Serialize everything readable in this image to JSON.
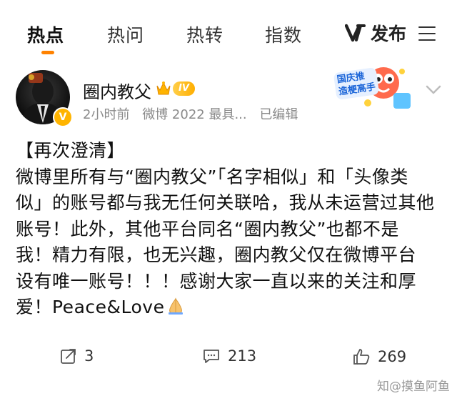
{
  "nav": {
    "tabs": [
      {
        "label": "热点",
        "active": true
      },
      {
        "label": "热问",
        "active": false
      },
      {
        "label": "热转",
        "active": false
      },
      {
        "label": "指数",
        "active": false
      }
    ],
    "publish_label": "发布",
    "accent": "#ff8200"
  },
  "post": {
    "username": "圈内教父",
    "level": "IV",
    "time": "2小时前",
    "source": "微博 2022 最具...",
    "edited": "已编辑",
    "promo": {
      "line1": "国庆推",
      "line2": "造梗高手"
    },
    "lines": [
      "【再次澄清】",
      "微博里所有与“圈内教父”「名字相似」和「头像类",
      "似」的账号都与我无任何关联哈，我从未运营过其他",
      "账号！此外，其他平台同名“圈内教父”也都不是",
      "我！精力有限，也无兴趣，圈内教父仅在微博平台",
      "设有唯一账号！！！感谢大家一直以来的关注和厚",
      "爱！Peace&Love"
    ]
  },
  "actions": {
    "reposts": "3",
    "comments": "213",
    "likes": "269"
  },
  "watermark": "知@摸鱼阿鱼"
}
